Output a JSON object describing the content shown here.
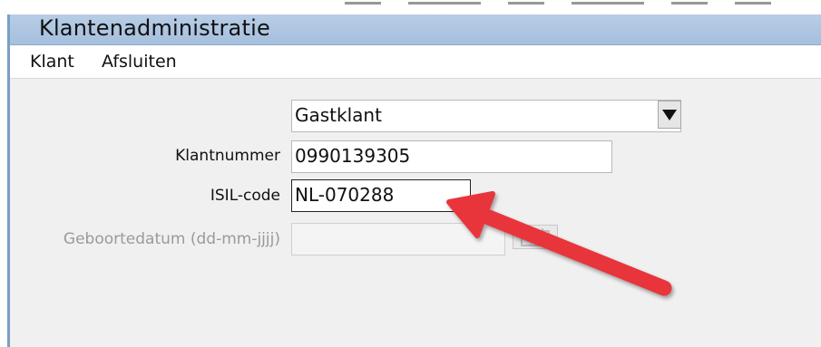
{
  "window": {
    "title": "Klantenadministratie"
  },
  "menu": {
    "items": [
      {
        "label": "Klant"
      },
      {
        "label": "Afsluiten"
      }
    ]
  },
  "form": {
    "customer_type": {
      "value": "Gastklant"
    },
    "customer_number": {
      "label": "Klantnummer",
      "value": "0990139305"
    },
    "isil_code": {
      "label": "ISIL-code",
      "value": "NL-070288"
    },
    "birth_date": {
      "label": "Geboortedatum (dd-mm-jjjj)",
      "value": ""
    }
  },
  "colors": {
    "titlebar": "#a5bfdd",
    "annotation_arrow": "#e8343a",
    "window_background": "#f0f0f0"
  },
  "icons": {
    "dropdown": "triangle-down-icon",
    "calendar": "calendar-icon",
    "annotation": "red-arrow"
  }
}
